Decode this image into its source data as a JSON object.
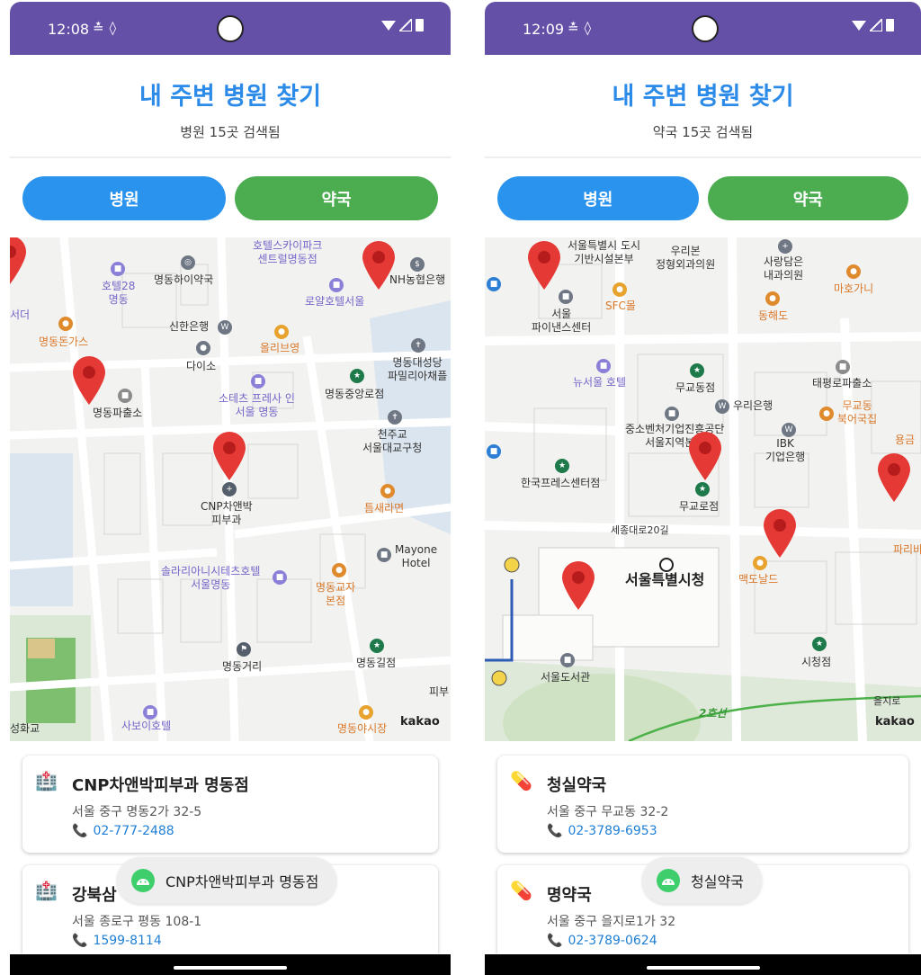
{
  "left": {
    "status": {
      "time": "12:08"
    },
    "title": "내 주변 병원 찾기",
    "subtitle": "병원 15곳 검색됨",
    "buttons": {
      "hospital": "병원",
      "pharmacy": "약국"
    },
    "map_labels": {
      "hotel_skypark": "호텔스카이파크\n센트럴명동점",
      "nh_bank": "NH농협은행",
      "hotel28": "호텔28\n명동",
      "myeongdong_haiyak": "명동하이약국",
      "royal_hotel": "로얄호텔서울",
      "seoul_der": "서더",
      "myeongdong_dongas": "명동돈가스",
      "shinhan": "신한은행",
      "daiso": "다이소",
      "olive": "올리브영",
      "police": "명동파출소",
      "sotetz": "소테츠 프레사 인\n서울 명동",
      "cathedral": "명동대성당\n파밀리아채플",
      "starbucks_central": "명동중앙로점",
      "cheonju": "천주교\n서울대교구청",
      "cnp": "CNP차앤박\n피부과",
      "teumsae": "틈새라면",
      "mayone": "Mayone\nHotel",
      "solaria": "솔라리아니시테츠호텔\n서울명동",
      "gyoja": "명동교자\n본점",
      "street": "명동거리",
      "gil": "명동길점",
      "pibu": "피부",
      "savoy": "사보이호텔",
      "market": "명동야시장",
      "hwagyo": "성화교",
      "kakao": "kakao"
    },
    "cards": [
      {
        "name": "CNP차앤박피부과 명동점",
        "address": "서울 중구 명동2가 32-5",
        "phone": "02-777-2488"
      },
      {
        "name": "강북삼",
        "address": "서울 종로구 평동 108-1",
        "phone": "1599-8114"
      }
    ],
    "toast": "CNP차앤박피부과 명동점",
    "icons": {
      "card": "hospital-icon",
      "toast": "android-icon"
    }
  },
  "right": {
    "status": {
      "time": "12:09"
    },
    "title": "내 주변 병원 찾기",
    "subtitle": "약국 15곳 검색됨",
    "buttons": {
      "hospital": "병원",
      "pharmacy": "약국"
    },
    "map_labels": {
      "city_infra": "서울특별시 도시\n기반시설본부",
      "wooribon": "우리본\n정형외과의원",
      "sarang": "사랑담은\n내과의원",
      "mahogany": "마호가니",
      "sfc": "SFC몰",
      "seoul_finance": "서울\n파이낸스센터",
      "donghae": "동해도",
      "new_seoul_hotel": "뉴서울 호텔",
      "mugyodong": "무교동점",
      "woori_bank": "우리은행",
      "taepyeong": "태평로파출소",
      "mugyodong_bugeo": "무교동\n북어국집",
      "sme": "중소벤처기업진흥공단\n서울지역본부",
      "ibk": "IBK\n기업은행",
      "yonggeum": "용금",
      "press": "한국프레스센터점",
      "mugyo_ro": "무교로점",
      "sejong": "세종대로20길",
      "paris": "파리바",
      "city_hall": "서울특별시청",
      "mcd": "맥도날드",
      "library": "서울도서관",
      "city_hall_store": "시청점",
      "line2": "2호선",
      "euljiro": "을지로",
      "kakao": "kakao"
    },
    "cards": [
      {
        "name": "청실약국",
        "address": "서울 중구 무교동 32-2",
        "phone": "02-3789-6953"
      },
      {
        "name": "명약국",
        "address": "서울 중구 을지로1가 32",
        "phone": "02-3789-0624"
      }
    ],
    "toast": "청실약국",
    "icons": {
      "card": "pill-icon",
      "toast": "android-icon"
    }
  },
  "colors": {
    "statusbar": "#6550a8",
    "title": "#2c8be8",
    "hospital_btn": "#2a93ed",
    "pharmacy_btn": "#4cad50",
    "pin": "#e53935",
    "phone_link": "#1f7fd4"
  }
}
